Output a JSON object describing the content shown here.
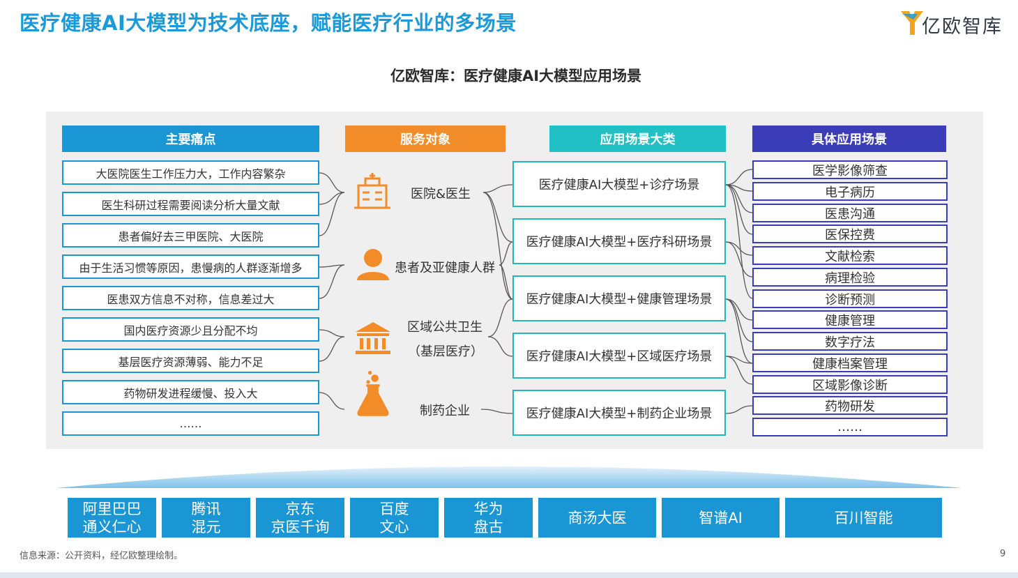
{
  "header": {
    "title": "医疗健康AI大模型为技术底座，赋能医疗行业的多场景",
    "logo_text": "亿欧智库"
  },
  "diagram": {
    "title": "亿欧智库：医疗健康AI大模型应用场景",
    "columns": {
      "pain_points": "主要痛点",
      "service_targets": "服务对象",
      "scenario_categories": "应用场景大类",
      "specific_scenarios": "具体应用场景"
    },
    "pain_points": [
      "大医院医生工作压力大，工作内容繁杂",
      "医生科研过程需要阅读分析大量文献",
      "患者偏好去三甲医院、大医院",
      "由于生活习惯等原因，患慢病的人群逐渐增多",
      "医患双方信息不对称，信息差过大",
      "国内医疗资源少且分配不均",
      "基层医疗资源薄弱、能力不足",
      "药物研发进程缓慢、投入大",
      "……"
    ],
    "service_targets": [
      {
        "label": "医院&医生",
        "sub": "",
        "icon": "hospital-icon"
      },
      {
        "label": "患者及亚健康人群",
        "sub": "",
        "icon": "person-icon"
      },
      {
        "label": "区域公共卫生",
        "sub": "（基层医疗）",
        "icon": "public-building-icon"
      },
      {
        "label": "制药企业",
        "sub": "",
        "icon": "flask-icon"
      }
    ],
    "scenario_categories": [
      "医疗健康AI大模型+诊疗场景",
      "医疗健康AI大模型+医疗科研场景",
      "医疗健康AI大模型+健康管理场景",
      "医疗健康AI大模型+区域医疗场景",
      "医疗健康AI大模型+制药企业场景"
    ],
    "specific_scenarios": [
      "医学影像筛查",
      "电子病历",
      "医患沟通",
      "医保控费",
      "文献检索",
      "病理检验",
      "诊断预测",
      "健康管理",
      "数字疗法",
      "健康档案管理",
      "区域影像诊断",
      "药物研发",
      "……"
    ],
    "vendors": [
      {
        "line1": "阿里巴巴",
        "line2": "通义仁心"
      },
      {
        "line1": "腾讯",
        "line2": "混元"
      },
      {
        "line1": "京东",
        "line2": "京医千询"
      },
      {
        "line1": "百度",
        "line2": "文心"
      },
      {
        "line1": "华为",
        "line2": "盘古"
      },
      {
        "line1": "商汤大医",
        "line2": ""
      },
      {
        "line1": "智谱AI",
        "line2": ""
      },
      {
        "line1": "百川智能",
        "line2": ""
      }
    ]
  },
  "footer": {
    "source": "信息来源：公开资料，经亿欧整理绘制。",
    "page_number": "9"
  },
  "colors": {
    "title_blue": "#1a9ad9",
    "pain_blue": "#1a96d4",
    "service_orange": "#f28c28",
    "category_teal": "#21c0c4",
    "specific_indigo": "#3a3cb8",
    "panel_gray": "#efefef"
  }
}
